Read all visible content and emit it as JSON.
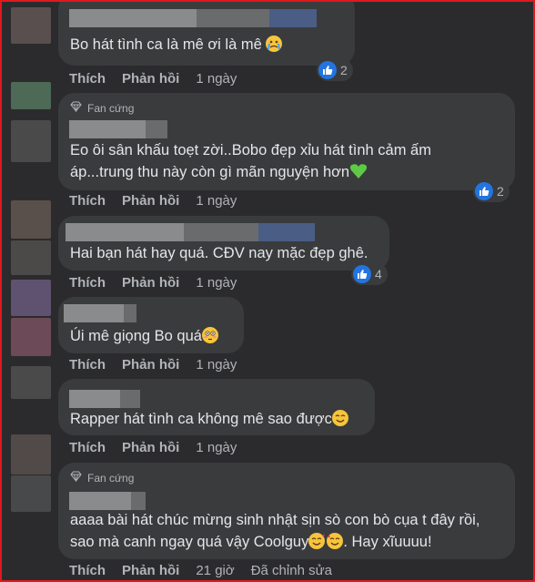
{
  "comments": [
    {
      "text": "Bo hát tình ca là mê ơi là mê",
      "emoji": "crying-face-icon",
      "actions": {
        "like": "Thích",
        "reply": "Phản hồi",
        "time": "1 ngày"
      },
      "reactions": "2"
    },
    {
      "badge": "Fan cứng",
      "text_lines": [
        "Eo ôi sân khấu toẹt zời..Bobo đẹp xỉu hát tình cảm ấm",
        "áp...trung thu này còn gì mãn nguyện hơn"
      ],
      "emoji": "green-heart-icon",
      "actions": {
        "like": "Thích",
        "reply": "Phản hồi",
        "time": "1 ngày"
      },
      "reactions": "2"
    },
    {
      "text": "Hai bạn hát hay quá. CĐV nay mặc đẹp ghê.",
      "actions": {
        "like": "Thích",
        "reply": "Phản hồi",
        "time": "1 ngày"
      },
      "reactions": "4"
    },
    {
      "text": "Úi mê giọng Bo quá",
      "emoji": "flushed-face-icon",
      "actions": {
        "like": "Thích",
        "reply": "Phản hồi",
        "time": "1 ngày"
      }
    },
    {
      "text": "Rapper hát tình ca không mê sao được",
      "emoji": "smiling-face-icon",
      "actions": {
        "like": "Thích",
        "reply": "Phản hồi",
        "time": "1 ngày"
      }
    },
    {
      "badge": "Fan cứng",
      "text_lines": [
        "aaaa bài hát chúc mừng sinh nhật sịn sò con bò cụa t đây rồi,",
        "sao mà canh ngay quá vậy Coolguy",
        ". Hay xĩuuuu!"
      ],
      "emoji": "smiling-hearts-icon",
      "actions": {
        "like": "Thích",
        "reply": "Phản hồi",
        "time": "21 giờ",
        "edited": "Đã chỉnh sửa"
      }
    }
  ],
  "colors": {
    "frame": "#e0191f",
    "background": "#2b2b2d",
    "bubble": "#3a3b3c",
    "like_blue": "#2374e1",
    "heart_green": "#5ec944"
  }
}
